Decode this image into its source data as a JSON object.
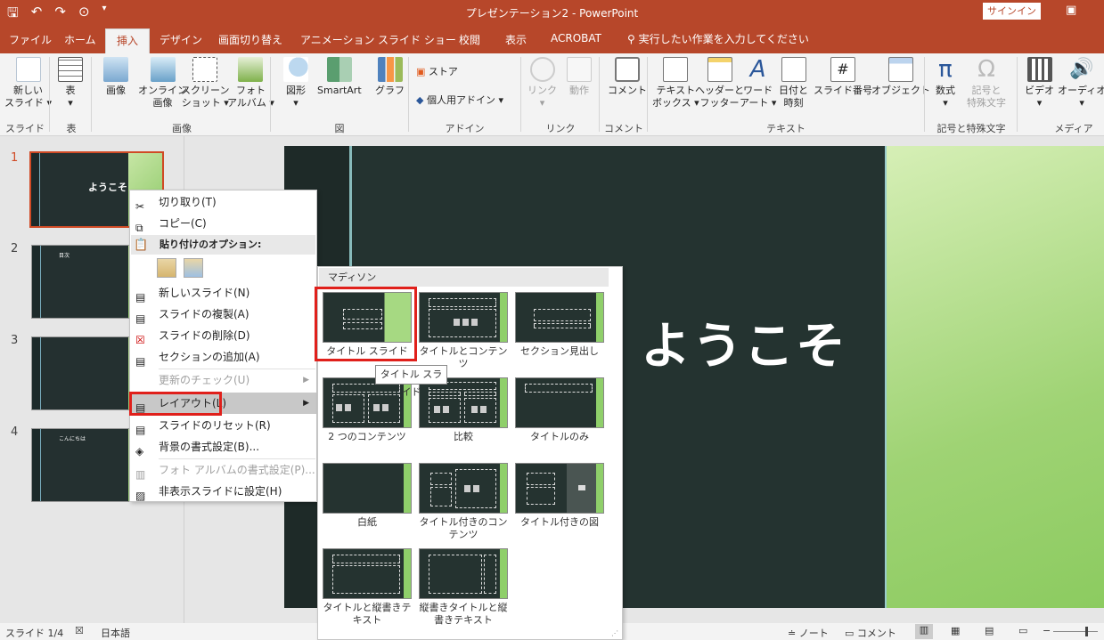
{
  "window": {
    "title": "プレゼンテーション2 - PowerPoint",
    "signin": "サインイン"
  },
  "tabs": [
    "ファイル",
    "ホーム",
    "挿入",
    "デザイン",
    "画面切り替え",
    "アニメーション",
    "スライド ショー",
    "校閲",
    "表示",
    "ACROBAT"
  ],
  "active_tab": "挿入",
  "tell_me": "実行したい作業を入力してください",
  "ribbon": {
    "buttons": [
      {
        "l1": "新しい",
        "l2": "スライド",
        "d": "▾"
      },
      {
        "l1": "表",
        "l2": "▾"
      },
      {
        "l1": "画像"
      },
      {
        "l1": "オンライン",
        "l2": "画像"
      },
      {
        "l1": "スクリーン",
        "l2": "ショット ▾"
      },
      {
        "l1": "フォト",
        "l2": "アルバム ▾"
      },
      {
        "l1": "図形",
        "l2": "▾"
      },
      {
        "l1": "SmartArt"
      },
      {
        "l1": "グラフ"
      },
      {
        "l1": "リンク",
        "l2": "▾"
      },
      {
        "l1": "動作"
      },
      {
        "l1": "コメント"
      },
      {
        "l1": "テキスト",
        "l2": "ボックス ▾"
      },
      {
        "l1": "ヘッダーと",
        "l2": "フッター"
      },
      {
        "l1": "ワード",
        "l2": "アート ▾"
      },
      {
        "l1": "日付と",
        "l2": "時刻"
      },
      {
        "l1": "スライド番号"
      },
      {
        "l1": "オブジェクト"
      },
      {
        "l1": "数式",
        "l2": "▾"
      },
      {
        "l1": "記号と",
        "l2": "特殊文字"
      },
      {
        "l1": "ビデオ",
        "l2": "▾"
      },
      {
        "l1": "オーディオ",
        "l2": "▾"
      }
    ],
    "store": "ストア",
    "addins": "個人用アドイン",
    "groups": [
      "スライド",
      "表",
      "画像",
      "図",
      "アドイン",
      "リンク",
      "コメント",
      "テキスト",
      "記号と特殊文字",
      "メディア"
    ]
  },
  "thumbnails": [
    "1",
    "2",
    "3",
    "4"
  ],
  "thumb_texts": [
    "ようこそ",
    "目次",
    "",
    "こんにちは"
  ],
  "slide": {
    "title": "ようこそ"
  },
  "context_menu": {
    "cut": "切り取り(T)",
    "copy": "コピー(C)",
    "paste_header": "貼り付けのオプション:",
    "new_slide": "新しいスライド(N)",
    "duplicate": "スライドの複製(A)",
    "delete": "スライドの削除(D)",
    "add_section": "セクションの追加(A)",
    "check_updates": "更新のチェック(U)",
    "layout": "レイアウト(L)",
    "reset": "スライドのリセット(R)",
    "bg_format": "背景の書式設定(B)...",
    "photo_album": "フォト アルバムの書式設定(P)...",
    "hide": "非表示スライドに設定(H)"
  },
  "layouts": {
    "header": "マディソン",
    "items": [
      "タイトル スライド",
      "タイトルとコンテンツ",
      "セクション見出し",
      "2 つのコンテンツ",
      "比較",
      "タイトルのみ",
      "白紙",
      "タイトル付きのコンテンツ",
      "タイトル付きの図",
      "タイトルと縦書きテキスト",
      "縦書きタイトルと縦書きテキスト"
    ]
  },
  "tooltip": "タイトル スライド",
  "status": {
    "slide": "スライド 1/4",
    "lang": "日本語",
    "notes": "ノート",
    "comments": "コメント"
  },
  "colors": {
    "accent": "#b7472a",
    "highlight": "#e0201b"
  }
}
